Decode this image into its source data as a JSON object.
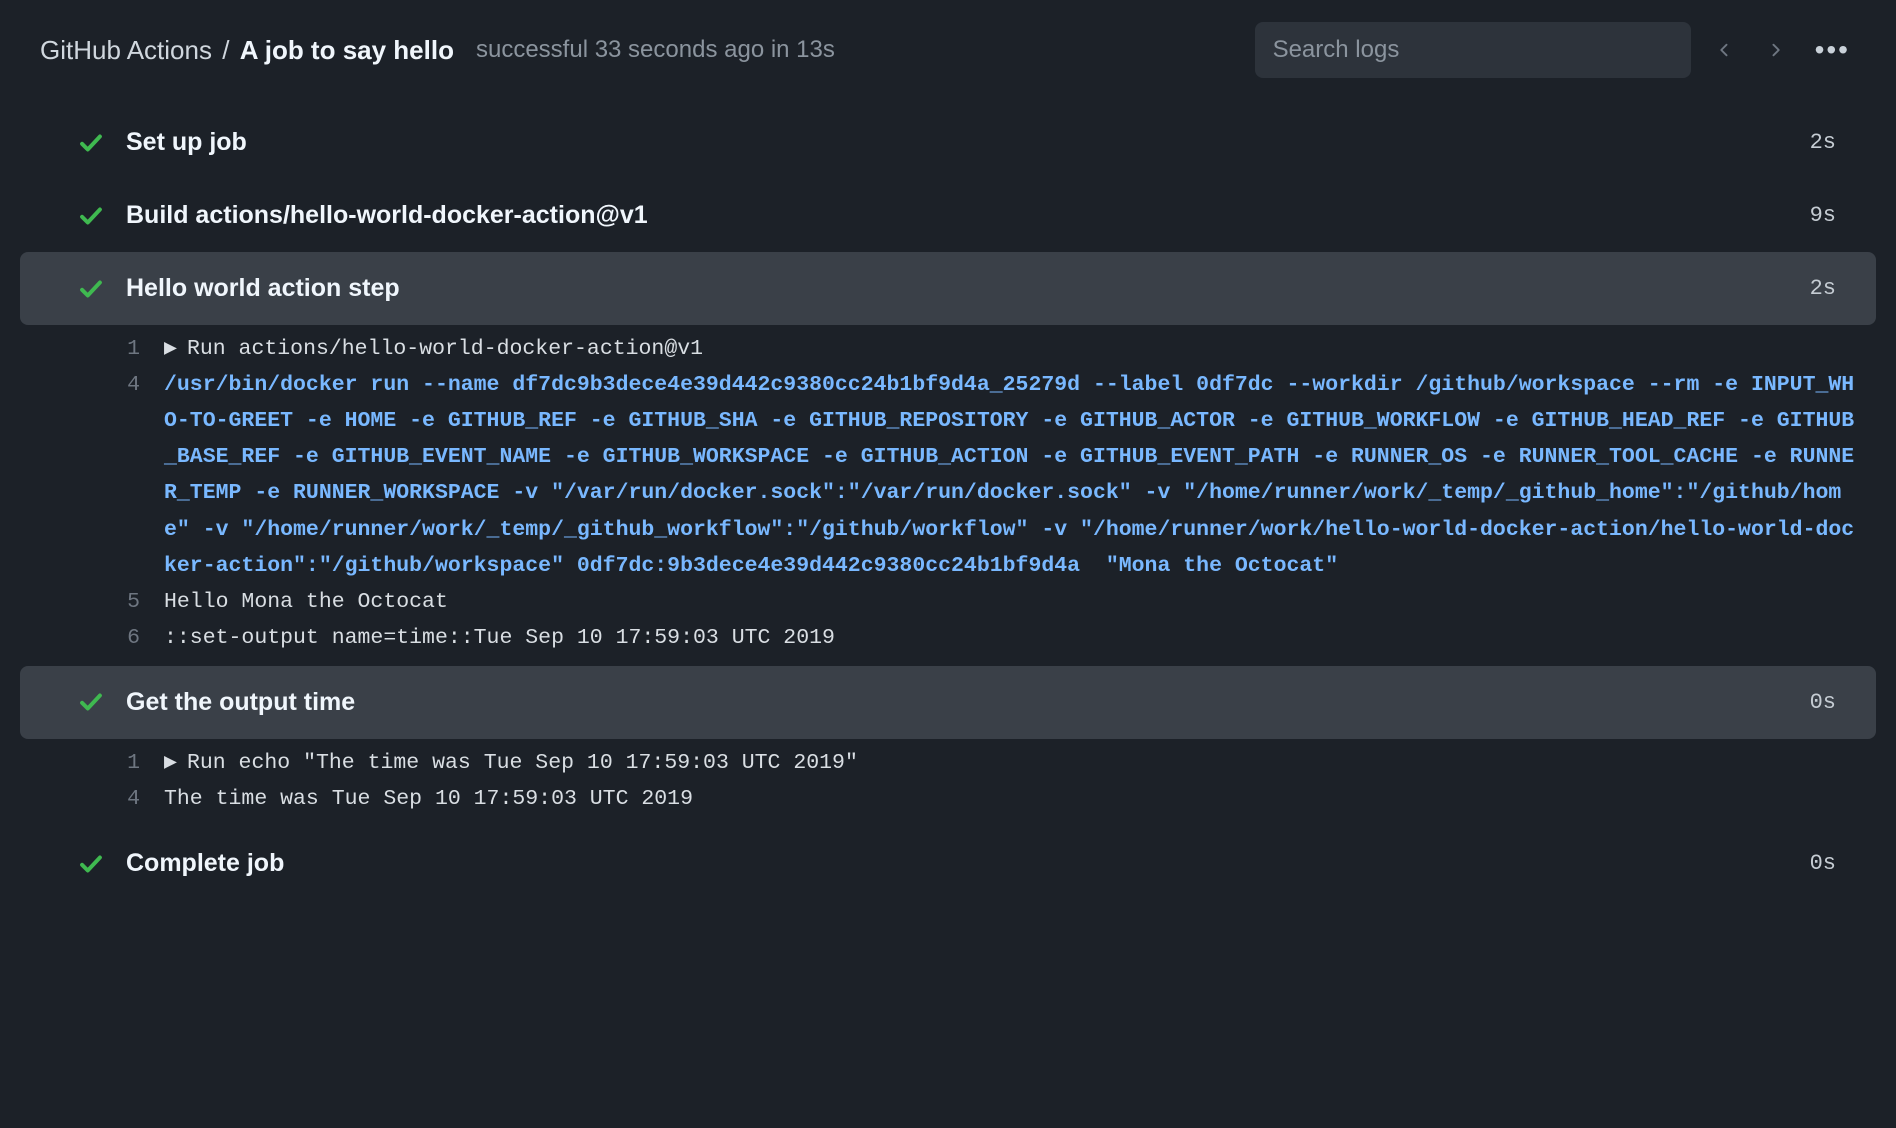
{
  "header": {
    "workflow": "GitHub Actions",
    "sep": "/",
    "job": "A job to say hello",
    "status": "successful 33 seconds ago in 13s",
    "search_placeholder": "Search logs"
  },
  "steps": [
    {
      "name": "Set up job",
      "duration": "2s",
      "expanded": false,
      "lines": []
    },
    {
      "name": "Build actions/hello-world-docker-action@v1",
      "duration": "9s",
      "expanded": false,
      "lines": []
    },
    {
      "name": "Hello world action step",
      "duration": "2s",
      "expanded": true,
      "lines": [
        {
          "n": "1",
          "disclosure": true,
          "text": "Run actions/hello-world-docker-action@v1",
          "class": ""
        },
        {
          "n": "4",
          "text": "/usr/bin/docker run --name df7dc9b3dece4e39d442c9380cc24b1bf9d4a_25279d --label 0df7dc --workdir /github/workspace --rm -e INPUT_WHO-TO-GREET -e HOME -e GITHUB_REF -e GITHUB_SHA -e GITHUB_REPOSITORY -e GITHUB_ACTOR -e GITHUB_WORKFLOW -e GITHUB_HEAD_REF -e GITHUB_BASE_REF -e GITHUB_EVENT_NAME -e GITHUB_WORKSPACE -e GITHUB_ACTION -e GITHUB_EVENT_PATH -e RUNNER_OS -e RUNNER_TOOL_CACHE -e RUNNER_TEMP -e RUNNER_WORKSPACE -v \"/var/run/docker.sock\":\"/var/run/docker.sock\" -v \"/home/runner/work/_temp/_github_home\":\"/github/home\" -v \"/home/runner/work/_temp/_github_workflow\":\"/github/workflow\" -v \"/home/runner/work/hello-world-docker-action/hello-world-docker-action\":\"/github/workspace\" 0df7dc:9b3dece4e39d442c9380cc24b1bf9d4a  \"Mona the Octocat\"",
          "class": "blue"
        },
        {
          "n": "5",
          "text": "Hello Mona the Octocat",
          "class": ""
        },
        {
          "n": "6",
          "text": "::set-output name=time::Tue Sep 10 17:59:03 UTC 2019",
          "class": ""
        }
      ]
    },
    {
      "name": "Get the output time",
      "duration": "0s",
      "expanded": true,
      "lines": [
        {
          "n": "1",
          "disclosure": true,
          "text": "Run echo \"The time was Tue Sep 10 17:59:03 UTC 2019\"",
          "class": ""
        },
        {
          "n": "4",
          "text": "The time was Tue Sep 10 17:59:03 UTC 2019",
          "class": ""
        }
      ]
    },
    {
      "name": "Complete job",
      "duration": "0s",
      "expanded": false,
      "lines": []
    }
  ]
}
